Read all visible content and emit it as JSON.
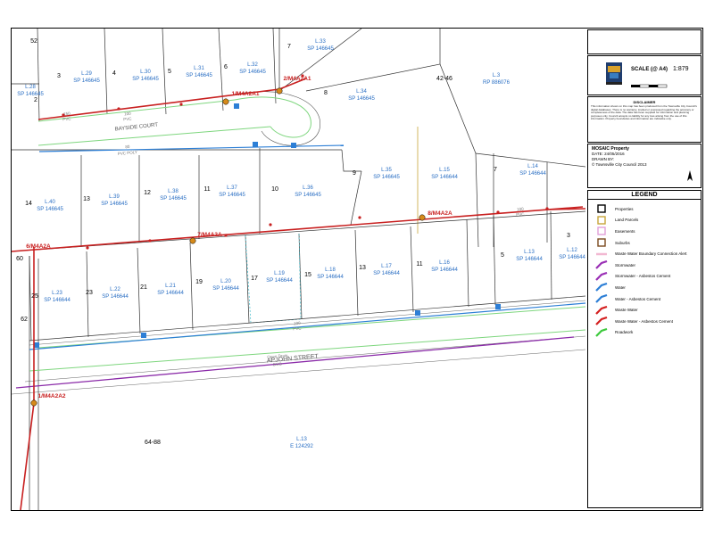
{
  "map": {
    "street_labels": {
      "bayside_court": "BAYSIDE COURT",
      "apjohn_street": "APJOHN STREET"
    },
    "pipe_labels": {
      "size_150_a": "150",
      "pvc_a": "PVC",
      "size_100_a": "100",
      "pvc_b": "PVC",
      "size_80": "80",
      "pvc_poly": "PVC POLY",
      "size_100_b": "100",
      "pvc_c": "PVC",
      "size_100_c": "100",
      "pvc_d": "PVC",
      "open_drain": "Open Drain",
      "duo": "DUO"
    },
    "node_labels": {
      "n1": "1/M4A2A1",
      "n2": "2/M4A2A1",
      "n3": "7/M4A2A",
      "n4": "8/M4A2A",
      "n5": "6/M4A2A",
      "n6": "1/M4A2A2"
    },
    "lot_numbers": {
      "n52": "52",
      "n3a": "3",
      "n4": "4",
      "n5": "5",
      "n6": "6",
      "n7a": "7",
      "n2": "2",
      "n8": "8",
      "n42_46": "42-46",
      "n9": "9",
      "n7b": "7",
      "n14": "14",
      "n13": "13",
      "n12": "12",
      "n11a": "11",
      "n10": "10",
      "n60": "60",
      "n25": "25",
      "n23": "23",
      "n21": "21",
      "n19": "19",
      "n17": "17",
      "n15": "15",
      "n13b": "13",
      "n11b": "11",
      "n5b": "5",
      "n3b": "3",
      "n62": "62",
      "n64_88": "64-88"
    },
    "lots": {
      "l28": [
        "L.28",
        "SP 146645"
      ],
      "l29": [
        "L.29",
        "SP 146645"
      ],
      "l30": [
        "L.30",
        "SP 146645"
      ],
      "l31": [
        "L.31",
        "SP 146645"
      ],
      "l32": [
        "L.32",
        "SP 146645"
      ],
      "l33": [
        "L.33",
        "SP 146645"
      ],
      "l34": [
        "L.34",
        "SP 146645"
      ],
      "l3": [
        "L.3",
        "RP 886076"
      ],
      "l35": [
        "L.35",
        "SP 146645"
      ],
      "l15": [
        "L.15",
        "SP 146644"
      ],
      "l14": [
        "L.14",
        "SP 146644"
      ],
      "l40": [
        "L.40",
        "SP 146645"
      ],
      "l39": [
        "L.39",
        "SP 146645"
      ],
      "l38": [
        "L.38",
        "SP 146645"
      ],
      "l37": [
        "L.37",
        "SP 146645"
      ],
      "l36": [
        "L.36",
        "SP 146645"
      ],
      "l23": [
        "L.23",
        "SP 146644"
      ],
      "l22": [
        "L.22",
        "SP 146644"
      ],
      "l21": [
        "L.21",
        "SP 146644"
      ],
      "l20": [
        "L.20",
        "SP 146644"
      ],
      "l19": [
        "L.19",
        "SP 146644"
      ],
      "l18": [
        "L.18",
        "SP 146644"
      ],
      "l17": [
        "L.17",
        "SP 146644"
      ],
      "l16": [
        "L.16",
        "SP 146644"
      ],
      "l13": [
        "L.13",
        "SP 146644"
      ],
      "l12": [
        "L.12",
        "SP 146644"
      ],
      "l13e": [
        "L.13",
        "E 124292"
      ]
    }
  },
  "sidebar": {
    "scale_label": "SCALE (@ A4)",
    "scale_value": "1:879",
    "disclaimer_title": "DISCLAIMER",
    "disclaimer_text": "This information shown on this map has been produced from the Townsville City Council's digital databases. There is no warranty, implied or expressed regarding the accuracy or completeness of the data. The data has been supplied for information and planning purposes only. Council accepts no liability for any loss arising from the use of this information. Property boundaries and information are indicative only.",
    "title": "MOSAIC Property",
    "date": "DATE: 24/05/2016",
    "drawn": "DRAWN BY:",
    "copyright": "© Townsville City Council 2013",
    "legend_title": "LEGEND",
    "legend_items": [
      {
        "label": "Properties",
        "icon": "square-outline-black",
        "color": "#000000"
      },
      {
        "label": "Land Parcels",
        "icon": "square-outline-gold",
        "color": "#c8a53a"
      },
      {
        "label": "Easements",
        "icon": "square-outline-pink",
        "color": "#e2a0d8"
      },
      {
        "label": "Suburbs",
        "icon": "square-outline-brown",
        "color": "#7a4a1e"
      },
      {
        "label": "Waste Water Boundary Connection Alert",
        "icon": "pink-dash",
        "color": "#f2b8d2"
      },
      {
        "label": "Stormwater",
        "icon": "purple-line",
        "color": "#9a2fb5"
      },
      {
        "label": "Stormwater - Asbestos Cement",
        "icon": "purple-line",
        "color": "#9a2fb5"
      },
      {
        "label": "Water",
        "icon": "blue-line",
        "color": "#2d7fd6"
      },
      {
        "label": "Water - Asbestos Cement",
        "icon": "blue-line",
        "color": "#2d7fd6"
      },
      {
        "label": "Waste Water",
        "icon": "red-line",
        "color": "#d42020"
      },
      {
        "label": "Waste Water - Asbestos Cement",
        "icon": "red-line",
        "color": "#d42020"
      },
      {
        "label": "Roadwork",
        "icon": "green-line",
        "color": "#3cc93c"
      }
    ]
  },
  "colors": {
    "lot_text": "#2a6fc4",
    "node_text": "#c82020",
    "sewer": "#c82020",
    "water": "#2d7fd6",
    "stormwater": "#8a2aa8",
    "road": "#7ed67e",
    "boundary": "#333333"
  }
}
